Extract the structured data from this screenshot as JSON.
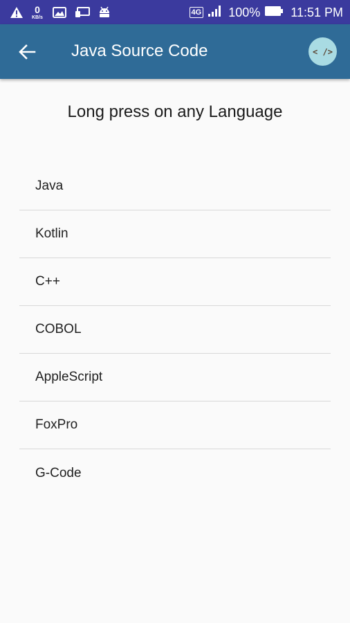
{
  "status_bar": {
    "data_speed_value": "0",
    "data_speed_unit": "KB/s",
    "network_type": "4G",
    "battery_percent": "100%",
    "time": "11:51 PM",
    "icons": [
      "warning-icon",
      "image-icon",
      "cast-icon",
      "android-icon",
      "signal-icon",
      "battery-icon"
    ]
  },
  "app_bar": {
    "title": "Java Source Code",
    "back_icon": "arrow-left-icon",
    "action_icon": "code-icon",
    "action_text": "< />",
    "background_color": "#2f6b97"
  },
  "instruction": "Long press on any Language",
  "languages": [
    {
      "label": "Java"
    },
    {
      "label": "Kotlin"
    },
    {
      "label": "C++"
    },
    {
      "label": "COBOL"
    },
    {
      "label": "AppleScript"
    },
    {
      "label": "FoxPro"
    },
    {
      "label": "G-Code"
    }
  ]
}
